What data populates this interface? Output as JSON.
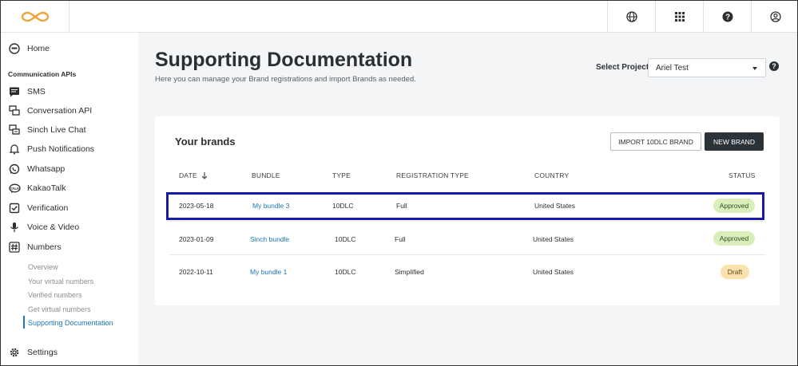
{
  "topbar": {
    "icons": [
      "globe-icon",
      "apps-grid-icon",
      "help-circle-icon",
      "account-icon"
    ]
  },
  "sidebar": {
    "home": "Home",
    "section": "Communication APIs",
    "items": [
      {
        "label": "SMS",
        "icon": "message-icon"
      },
      {
        "label": "Conversation API",
        "icon": "chat-bubbles-icon"
      },
      {
        "label": "Sinch Live Chat",
        "icon": "live-chat-icon"
      },
      {
        "label": "Push Notifications",
        "icon": "bell-icon"
      },
      {
        "label": "Whatsapp",
        "icon": "whatsapp-icon"
      },
      {
        "label": "KakaoTalk",
        "icon": "kakaotalk-icon"
      },
      {
        "label": "Verification",
        "icon": "checkbox-icon"
      },
      {
        "label": "Voice & Video",
        "icon": "microphone-icon"
      },
      {
        "label": "Numbers",
        "icon": "hash-icon"
      }
    ],
    "sub_items": [
      "Overview",
      "Your virtual numbers",
      "Verified numbers",
      "Get virtual numbers",
      "Supporting Documentation"
    ],
    "settings": "Settings"
  },
  "main": {
    "title": "Supporting Documentation",
    "subtitle": "Here you can manage your Brand registrations and import Brands as needed.",
    "project_label": "Select Project",
    "project_value": "Ariel Test",
    "help": "?"
  },
  "card": {
    "title": "Your brands",
    "import_label": "IMPORT 10DLC BRAND",
    "new_label": "NEW BRAND",
    "headers": {
      "date": "DATE",
      "bundle": "BUNDLE",
      "type": "TYPE",
      "registration": "REGISTRATION TYPE",
      "country": "COUNTRY",
      "status": "STATUS"
    },
    "rows": [
      {
        "date": "2023-05-18",
        "bundle": "My bundle 3",
        "type": "10DLC",
        "registration": "Full",
        "country": "United States",
        "status": "Approved"
      },
      {
        "date": "2023-01-09",
        "bundle": "Sinch bundle",
        "type": "10DLC",
        "registration": "Full",
        "country": "United States",
        "status": "Approved"
      },
      {
        "date": "2022-10-11",
        "bundle": "My bundle 1",
        "type": "10DLC",
        "registration": "Simplified",
        "country": "United States",
        "status": "Draft"
      }
    ]
  },
  "colors": {
    "accent": "#1b77b5",
    "logo": "#f0a338",
    "highlight": "#1a1aa8",
    "approved": "#d9eeb9",
    "draft": "#fbe2ad"
  }
}
